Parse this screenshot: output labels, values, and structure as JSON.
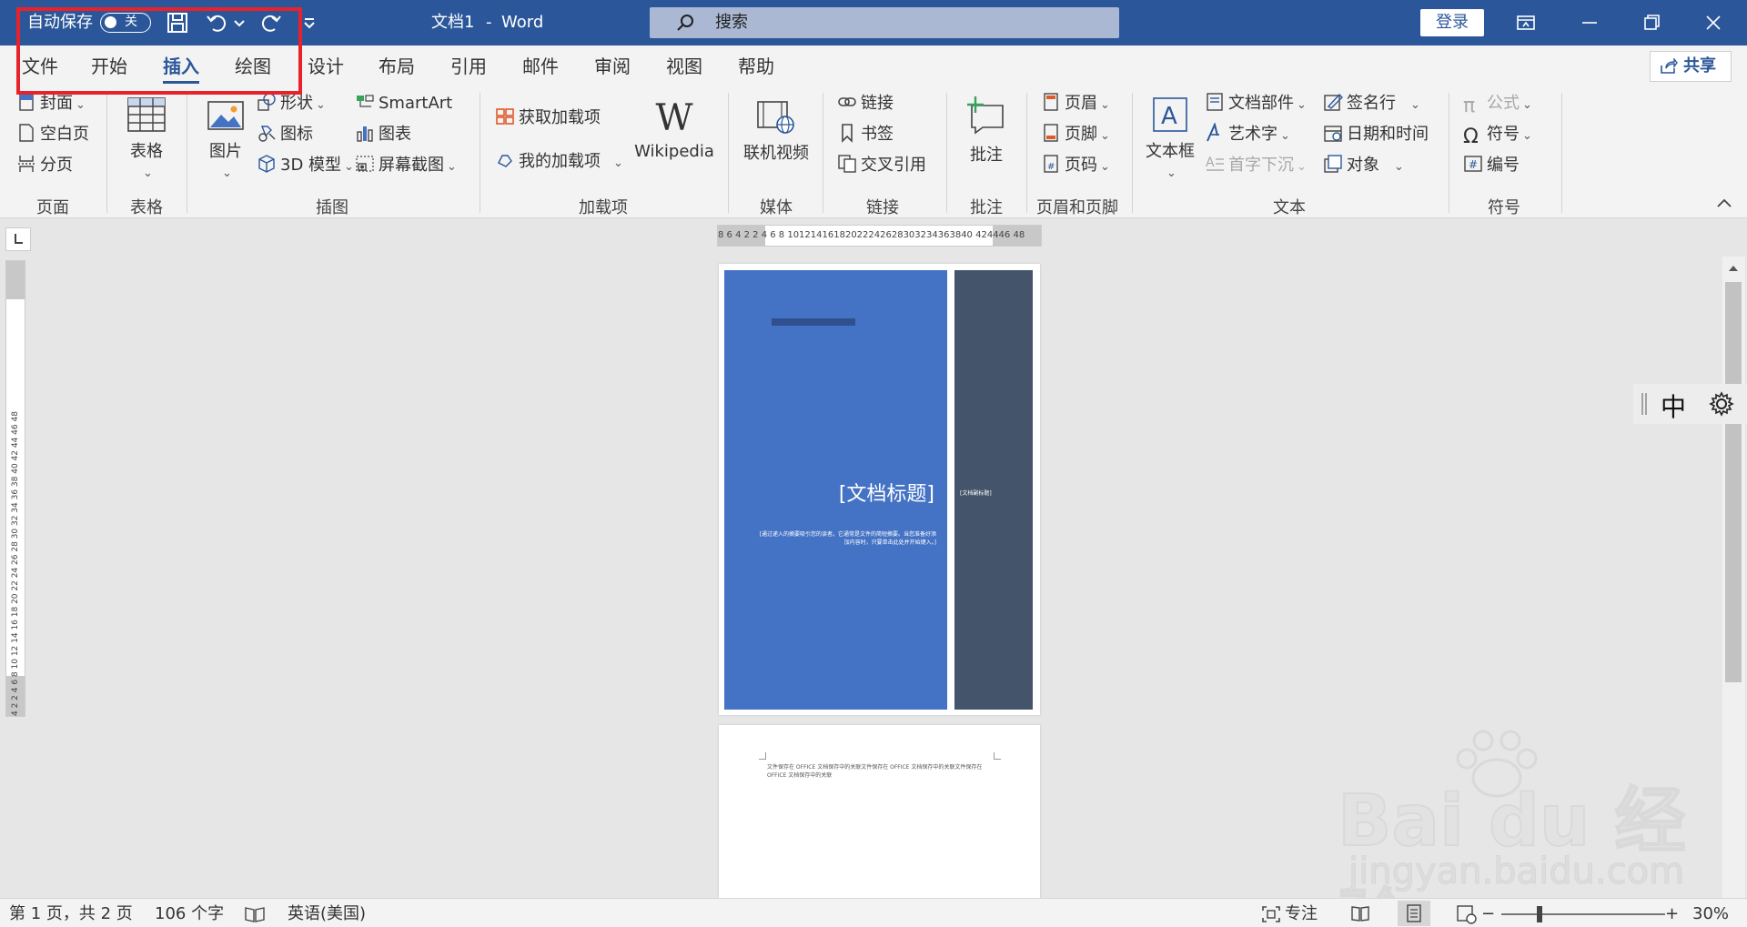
{
  "titlebar": {
    "autosave_label": "自动保存",
    "autosave_state": "关",
    "doc_title": "文档1",
    "separator": "-",
    "app_name": "Word",
    "search_placeholder": "搜索",
    "login_label": "登录",
    "brand_color": "#2b579a"
  },
  "tabs": [
    {
      "label": "文件"
    },
    {
      "label": "开始"
    },
    {
      "label": "插入"
    },
    {
      "label": "绘图"
    },
    {
      "label": "设计"
    },
    {
      "label": "布局"
    },
    {
      "label": "引用"
    },
    {
      "label": "邮件"
    },
    {
      "label": "审阅"
    },
    {
      "label": "视图"
    },
    {
      "label": "帮助"
    }
  ],
  "share_label": "共享",
  "ribbon": {
    "pages": {
      "label": "页面",
      "cover": "封面",
      "blank": "空白页",
      "break": "分页"
    },
    "tables": {
      "label": "表格",
      "table": "表格"
    },
    "illustrations": {
      "label": "插图",
      "pictures": "图片",
      "shapes": "形状",
      "icons": "图标",
      "models": "3D 模型",
      "smartart": "SmartArt",
      "chart": "图表",
      "screenshot": "屏幕截图"
    },
    "addins": {
      "label": "加载项",
      "get": "获取加载项",
      "my": "我的加载项",
      "wikipedia": "Wikipedia"
    },
    "media": {
      "label": "媒体",
      "online_video": "联机视频"
    },
    "links": {
      "label": "链接",
      "link": "链接",
      "bookmark": "书签",
      "crossref": "交叉引用"
    },
    "comments": {
      "label": "批注",
      "comment": "批注"
    },
    "header_footer": {
      "label": "页眉和页脚",
      "header": "页眉",
      "footer": "页脚",
      "page_number": "页码"
    },
    "text": {
      "label": "文本",
      "textbox": "文本框",
      "quick_parts": "文档部件",
      "wordart": "艺术字",
      "dropcap": "首字下沉",
      "signature": "签名行",
      "datetime": "日期和时间",
      "object": "对象"
    },
    "symbols": {
      "label": "符号",
      "equation": "公式",
      "symbol": "符号",
      "number": "编号"
    }
  },
  "ruler": {
    "horizontal": "8 6 4 2  2 4 6 8 10121416182022242628303234363840 424446 48",
    "vertical": "4 2  2 4 6 8 10 12 14 16 18 20 22 24 26 28 30 32 34 36 38 40 42 44 46 48"
  },
  "document": {
    "cover_title": "[文档标题]",
    "cover_abstract": "[通过递入的摘要吸引您的读者。它通常是文件的简短摘要。当您准备好添加内容时，只要单击此处并开始键入。]",
    "cover_subtitle": "[文档副标题]",
    "cover_color": "#4472c4",
    "sidebar_color": "#44546a",
    "page2_text": "文件保存在 OFFICE 文档保存中的关联文件保存在 OFFICE 文档保存中的关联文件保存在 OFFICE 文档保存中的关联"
  },
  "ime": {
    "mode": "中"
  },
  "statusbar": {
    "page_info": "第 1 页，共 2 页",
    "word_count": "106 个字",
    "language": "英语(美国)",
    "focus": "专注",
    "zoom": "30%",
    "zoom_minus": "−",
    "zoom_plus": "+"
  },
  "watermark": {
    "brand": "Bai du 经验",
    "url": "jingyan.baidu.com"
  }
}
